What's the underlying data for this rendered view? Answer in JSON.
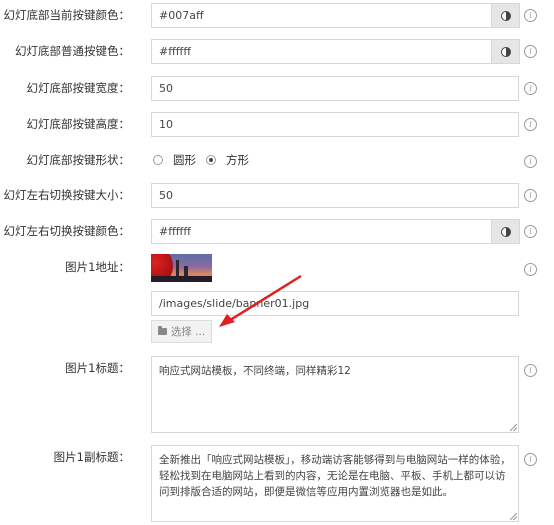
{
  "fields": {
    "current_btn_color": {
      "label": "幻灯底部当前按键颜色：",
      "value": "#007aff"
    },
    "normal_btn_color": {
      "label": "幻灯底部普通按键色：",
      "value": "#ffffff"
    },
    "btn_width": {
      "label": "幻灯底部按键宽度：",
      "value": "50"
    },
    "btn_height": {
      "label": "幻灯底部按键高度：",
      "value": "10"
    },
    "btn_shape": {
      "label": "幻灯底部按键形状：",
      "options": [
        "圆形",
        "方形"
      ],
      "selected": "方形"
    },
    "switch_size": {
      "label": "幻灯左右切换按键大小：",
      "value": "50"
    },
    "switch_color": {
      "label": "幻灯左右切换按键颜色：",
      "value": "#ffffff"
    },
    "image1_url": {
      "label": "图片1地址：",
      "value": "/images/slide/banner01.jpg",
      "select_button": "选择 ..."
    },
    "image1_title": {
      "label": "图片1标题：",
      "value": "响应式网站模板，不同终端，同样精彩12"
    },
    "image1_subtitle": {
      "label": "图片1副标题：",
      "value": "全新推出「响应式网站模板」，移动端访客能够得到与电脑网站一样的体验，轻松找到在电脑网站上看到的内容，无论是在电脑、平板、手机上都可以访问到排版合适的网站，即便是微信等应用内置浏览器也是如此。"
    }
  },
  "icons": {
    "help": "help-circle-icon",
    "color_picker": "contrast-icon",
    "folder": "folder-open-icon"
  },
  "colors": {
    "accent": "#007aff",
    "annotation_arrow": "#e02020"
  }
}
